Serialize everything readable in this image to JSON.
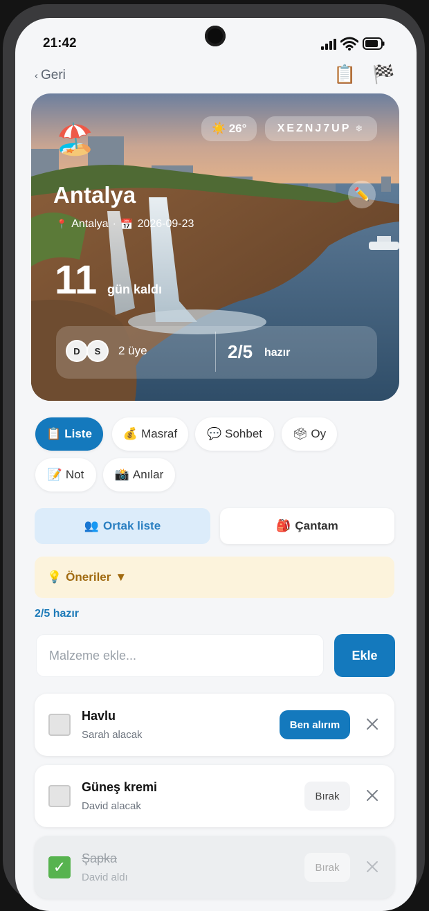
{
  "status_bar": {
    "time": "21:42"
  },
  "nav": {
    "back_label": "Geri"
  },
  "trip": {
    "weather": "26°",
    "code": "XEZNJ7UP",
    "title": "Antalya",
    "location": "Antalya",
    "separator": "·",
    "date": "2026-09-23",
    "days_count": "11",
    "days_label": "gün kaldı",
    "members": [
      {
        "initial": "D"
      },
      {
        "initial": "S"
      }
    ],
    "members_label": "2 üye",
    "ready_count": "2/5",
    "ready_label": "hazır"
  },
  "tabs": [
    {
      "icon": "📋",
      "label": "Liste",
      "active": true
    },
    {
      "icon": "💰",
      "label": "Masraf"
    },
    {
      "icon": "💬",
      "label": "Sohbet"
    },
    {
      "icon": "🗳",
      "label": "Oy"
    },
    {
      "icon": "📝",
      "label": "Not"
    },
    {
      "icon": "📸",
      "label": "Anılar"
    }
  ],
  "segments": {
    "shared_label": "Ortak liste",
    "bag_label": "Çantam"
  },
  "suggestions": {
    "label": "Öneriler",
    "caret": "▼"
  },
  "list": {
    "ready_text": "2/5 hazır",
    "input_placeholder": "Malzeme ekle...",
    "add_label": "Ekle",
    "items": [
      {
        "name": "Havlu",
        "sub": "Sarah alacak",
        "action": "Ben alırım",
        "done": false
      },
      {
        "name": "Güneş kremi",
        "sub": "David alacak",
        "action": "Bırak",
        "done": false
      },
      {
        "name": "Şapka",
        "sub": "David aldı",
        "action": "Bırak",
        "done": true
      }
    ]
  },
  "colors": {
    "accent": "#1479bd",
    "check_green": "#57b34f",
    "suggestion_bg": "#fcf3dc"
  }
}
